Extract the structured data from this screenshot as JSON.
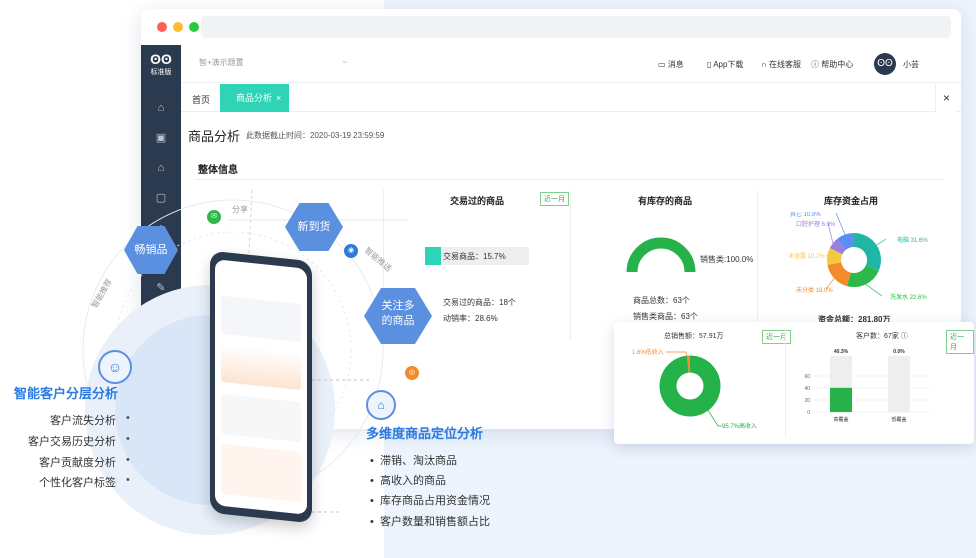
{
  "browser": {
    "logo_label": "标准版",
    "demo_select": "智+演示题置",
    "nav": {
      "messages": "消息",
      "app_download": "App下载",
      "online_service": "在线客服",
      "help_center": "帮助中心",
      "user_name": "小芸"
    },
    "tabs": {
      "home": "首页",
      "active": "商品分析"
    },
    "page": {
      "title": "商品分析",
      "data_time": "此数据截止时间：2020-03-19 23:59:59",
      "section_title": "整体信息"
    },
    "panel1": {
      "title": "交易过的商品",
      "badge": "近一月",
      "bar_label": "交易商品：15.7%",
      "bar_value": 15.7,
      "stat1": "交易过的商品：18个",
      "stat2": "动销率：28.6%"
    },
    "panel2": {
      "title": "有库存的商品",
      "gauge_label": "销售类:100.0%",
      "gauge_value": 100.0,
      "stat1": "商品总数：63个",
      "stat2": "销售类商品：63个"
    },
    "panel3": {
      "title": "库存资金占用",
      "total": "资金总额：281.80万"
    },
    "float_card": {
      "left_title": "总销售额：57.91万",
      "left_badge": "近一月",
      "right_title": "客户数：67家",
      "right_badge": "近一月"
    }
  },
  "marketing": {
    "hex1": "畅销品",
    "hex2": "新到货",
    "hex3_line1": "关注多",
    "hex3_line2": "的商品",
    "arc_share": "分享",
    "arc_smart_push": "智能推送",
    "arc_smart_recommend": "智能推荐",
    "left_title": "智能客户分层分析",
    "left_items": [
      "客户流失分析",
      "客户交易历史分析",
      "客户贡献度分析",
      "个性化客户标签"
    ],
    "right_title": "多维度商品定位分析",
    "right_items": [
      "滞销、淘汰商品",
      "高收入的商品",
      "库存商品占用资金情况",
      "客户数量和销售额占比"
    ]
  },
  "colors": {
    "accent": "#2fd3b5",
    "brand_blue": "#2c7be0",
    "sidebar": "#2b3a4f",
    "green": "#25b24a"
  },
  "chart_data": [
    {
      "type": "pie",
      "title": "库存资金占用",
      "labels": [
        "电脑",
        "洗发水",
        "未分类",
        "沐浴露",
        "口腔护理",
        "其它"
      ],
      "display_labels": [
        "电脑 31.6%",
        "洗发水 22.6%",
        "未分类 18.0%",
        "沐浴露 10.2%",
        "口腔护理 6.9%",
        "其它 10.8%"
      ],
      "values": [
        31.6,
        22.6,
        18.0,
        10.2,
        6.9,
        10.8
      ],
      "colors": [
        "#1fb6a6",
        "#2fb84a",
        "#f28b2a",
        "#f6c842",
        "#9b7fe0",
        "#5a8ef0"
      ]
    },
    {
      "type": "pie",
      "title": "总销售额：57.91万",
      "labels": [
        "高收入",
        "低收入"
      ],
      "display_labels": [
        "95.7%高收入",
        "1.6%低收入"
      ],
      "values": [
        95.7,
        1.6
      ],
      "colors": [
        "#25b24a",
        "#f28b2a"
      ]
    },
    {
      "type": "bar",
      "title": "客户数：67家",
      "categories": [
        "高覆盖",
        "低覆盖"
      ],
      "values": [
        40.3,
        0.0
      ],
      "value_labels": [
        "40.3%",
        "0.0%"
      ],
      "ylim": [
        0,
        80
      ],
      "yticks": [
        "0",
        "20",
        "40",
        "60"
      ]
    }
  ]
}
